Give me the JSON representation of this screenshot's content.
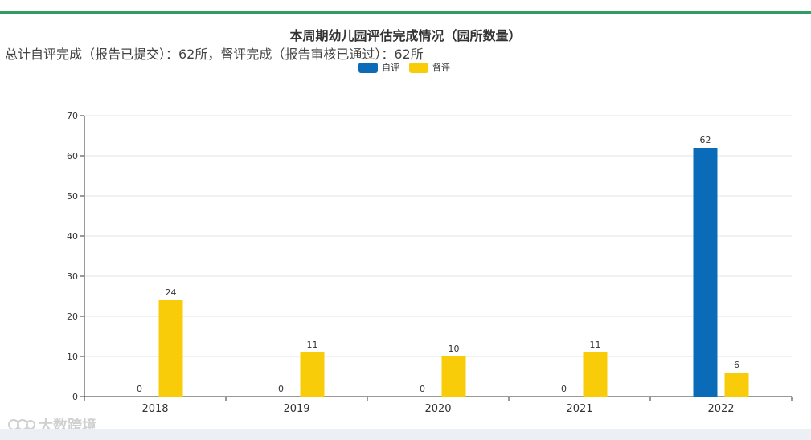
{
  "header": {
    "title": "本周期幼儿园评估完成情况（园所数量）",
    "summary": "总计自评完成（报告已提交）：62所，督评完成（报告审核已通过）：62所"
  },
  "watermark": {
    "text": "大数跨境",
    "icon": "logo-icon"
  },
  "colors": {
    "self_eval": "#0a6cb8",
    "supervision": "#f9cc0a",
    "top_rule": "#2e9e63"
  },
  "chart_data": {
    "type": "bar",
    "title": "本周期幼儿园评估完成情况（园所数量）",
    "categories": [
      "2018",
      "2019",
      "2020",
      "2021",
      "2022"
    ],
    "series": [
      {
        "name": "自评",
        "color": "#0a6cb8",
        "values": [
          0,
          0,
          0,
          0,
          62
        ]
      },
      {
        "name": "督评",
        "color": "#f9cc0a",
        "values": [
          24,
          11,
          10,
          11,
          6
        ]
      }
    ],
    "ylim": [
      0,
      70
    ],
    "yticks": [
      0,
      10,
      20,
      30,
      40,
      50,
      60,
      70
    ],
    "grid": true,
    "legend_position": "top-center"
  }
}
